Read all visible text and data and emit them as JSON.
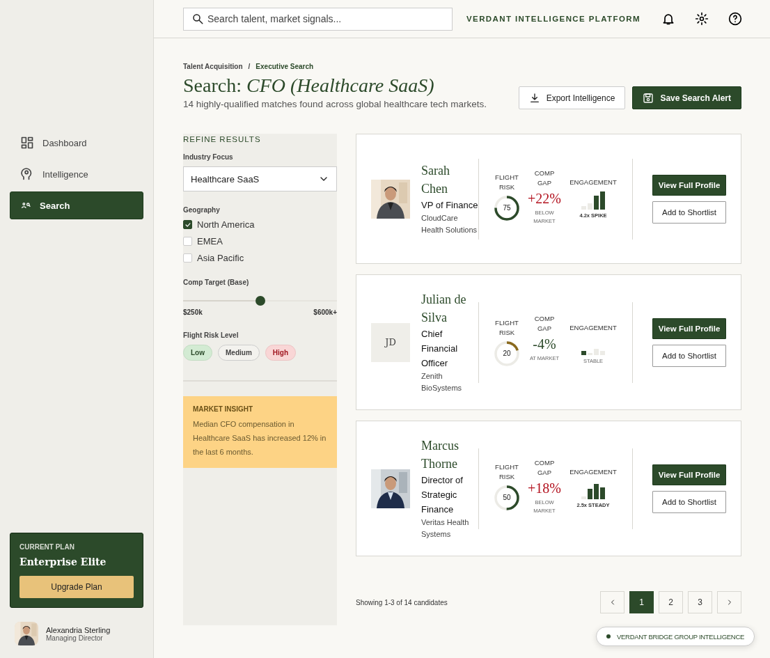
{
  "sidebar": {
    "nav": [
      {
        "label": "Dashboard",
        "selected": false
      },
      {
        "label": "Intelligence",
        "selected": false
      },
      {
        "label": "Search",
        "selected": true
      }
    ],
    "plan": {
      "caption": "CURRENT PLAN",
      "name": "Enterprise Elite",
      "button": "Upgrade Plan"
    },
    "user": {
      "name": "Alexandria Sterling",
      "role": "Managing Director",
      "avatar": {
        "kind": "picture"
      }
    }
  },
  "topbar": {
    "search": {
      "placeholder": "Search talent, market signals..."
    },
    "brand": "VERDANT INTELLIGENCE PLATFORM"
  },
  "header": {
    "breadcrumb": [
      "Talent Acquisition",
      "Executive Search"
    ],
    "separator": "/",
    "title": "Search: *CFO (Healthcare SaaS)*",
    "subtitle": "14 highly-qualified matches found across global healthcare tech markets.",
    "buttons": [
      {
        "label": "Export Intelligence",
        "kind": "secondary"
      },
      {
        "label": "Save Search Alert",
        "kind": "primary"
      }
    ]
  },
  "filters": {
    "title": "REFINE RESULTS",
    "industry": {
      "label": "Industry Focus",
      "value": "Healthcare SaaS"
    },
    "geography": {
      "label": "Geography",
      "options": [
        {
          "label": "North America",
          "checked": true
        },
        {
          "label": "EMEA",
          "checked": false
        },
        {
          "label": "Asia Pacific",
          "checked": false
        }
      ]
    },
    "comp_target": {
      "label": "Comp Target (Base)",
      "level": 0.5,
      "min": "$250k",
      "max": "$600k+"
    },
    "flight_risk": {
      "label": "Flight Risk Level",
      "chips": [
        {
          "label": "Low",
          "kind": "low"
        },
        {
          "label": "Medium",
          "kind": "medium"
        },
        {
          "label": "High",
          "kind": "high"
        }
      ]
    },
    "insight": {
      "title": "MARKET INSIGHT",
      "text": "Median CFO compensation in Healthcare SaaS has increased 12% in the last 6 months."
    }
  },
  "candidates": [
    {
      "name": "Sarah Chen",
      "title": "VP of Finance",
      "company": "CloudCare Health Solutions",
      "avatar": {
        "kind": "picture"
      },
      "labels": [
        "FLIGHT RISK",
        "COMP GAP",
        "ENGAGEMENT"
      ],
      "flight_risk": {
        "value": "75",
        "level": 0.75,
        "color": "#2c4a2a"
      },
      "comp_gap": {
        "value": "+22%",
        "note": "BELOW MARKET",
        "color": "#b3121f"
      },
      "engagement": {
        "kind": "spike",
        "note": "4.2x SPIKE"
      },
      "actions": [
        "View Full Profile",
        "Add to Shortlist"
      ]
    },
    {
      "name": "Julian de Silva",
      "title": "Chief Financial Officer",
      "company": "Zenith BioSystems",
      "avatar": {
        "kind": "initials",
        "text": "JD"
      },
      "labels": [
        "FLIGHT RISK",
        "COMP GAP",
        "ENGAGEMENT"
      ],
      "flight_risk": {
        "value": "20",
        "level": 0.2,
        "color": "#8a6a1e"
      },
      "comp_gap": {
        "value": "-4%",
        "note": "AT MARKET",
        "color": "#2c4a2a"
      },
      "engagement": {
        "kind": "flat",
        "note": "STABLE"
      },
      "actions": [
        "View Full Profile",
        "Add to Shortlist"
      ]
    },
    {
      "name": "Marcus Thorne",
      "title": "Director of Strategic Finance",
      "company": "Veritas Health Systems",
      "avatar": {
        "kind": "picture"
      },
      "labels": [
        "FLIGHT RISK",
        "COMP GAP",
        "ENGAGEMENT"
      ],
      "flight_risk": {
        "value": "50",
        "level": 0.5,
        "color": "#2c4a2a"
      },
      "comp_gap": {
        "value": "+18%",
        "note": "BELOW MARKET",
        "color": "#b3121f"
      },
      "engagement": {
        "kind": "steady",
        "note": "2.5x STEADY"
      },
      "actions": [
        "View Full Profile",
        "Add to Shortlist"
      ]
    }
  ],
  "footer": {
    "summary": "Showing 1-3 of 14 candidates",
    "pages": [
      {
        "label": "1",
        "selected": true
      },
      {
        "label": "2",
        "selected": false
      },
      {
        "label": "3",
        "selected": false
      }
    ]
  },
  "toast": {
    "text": "VERDANT BRIDGE GROUP INTELLIGENCE"
  }
}
